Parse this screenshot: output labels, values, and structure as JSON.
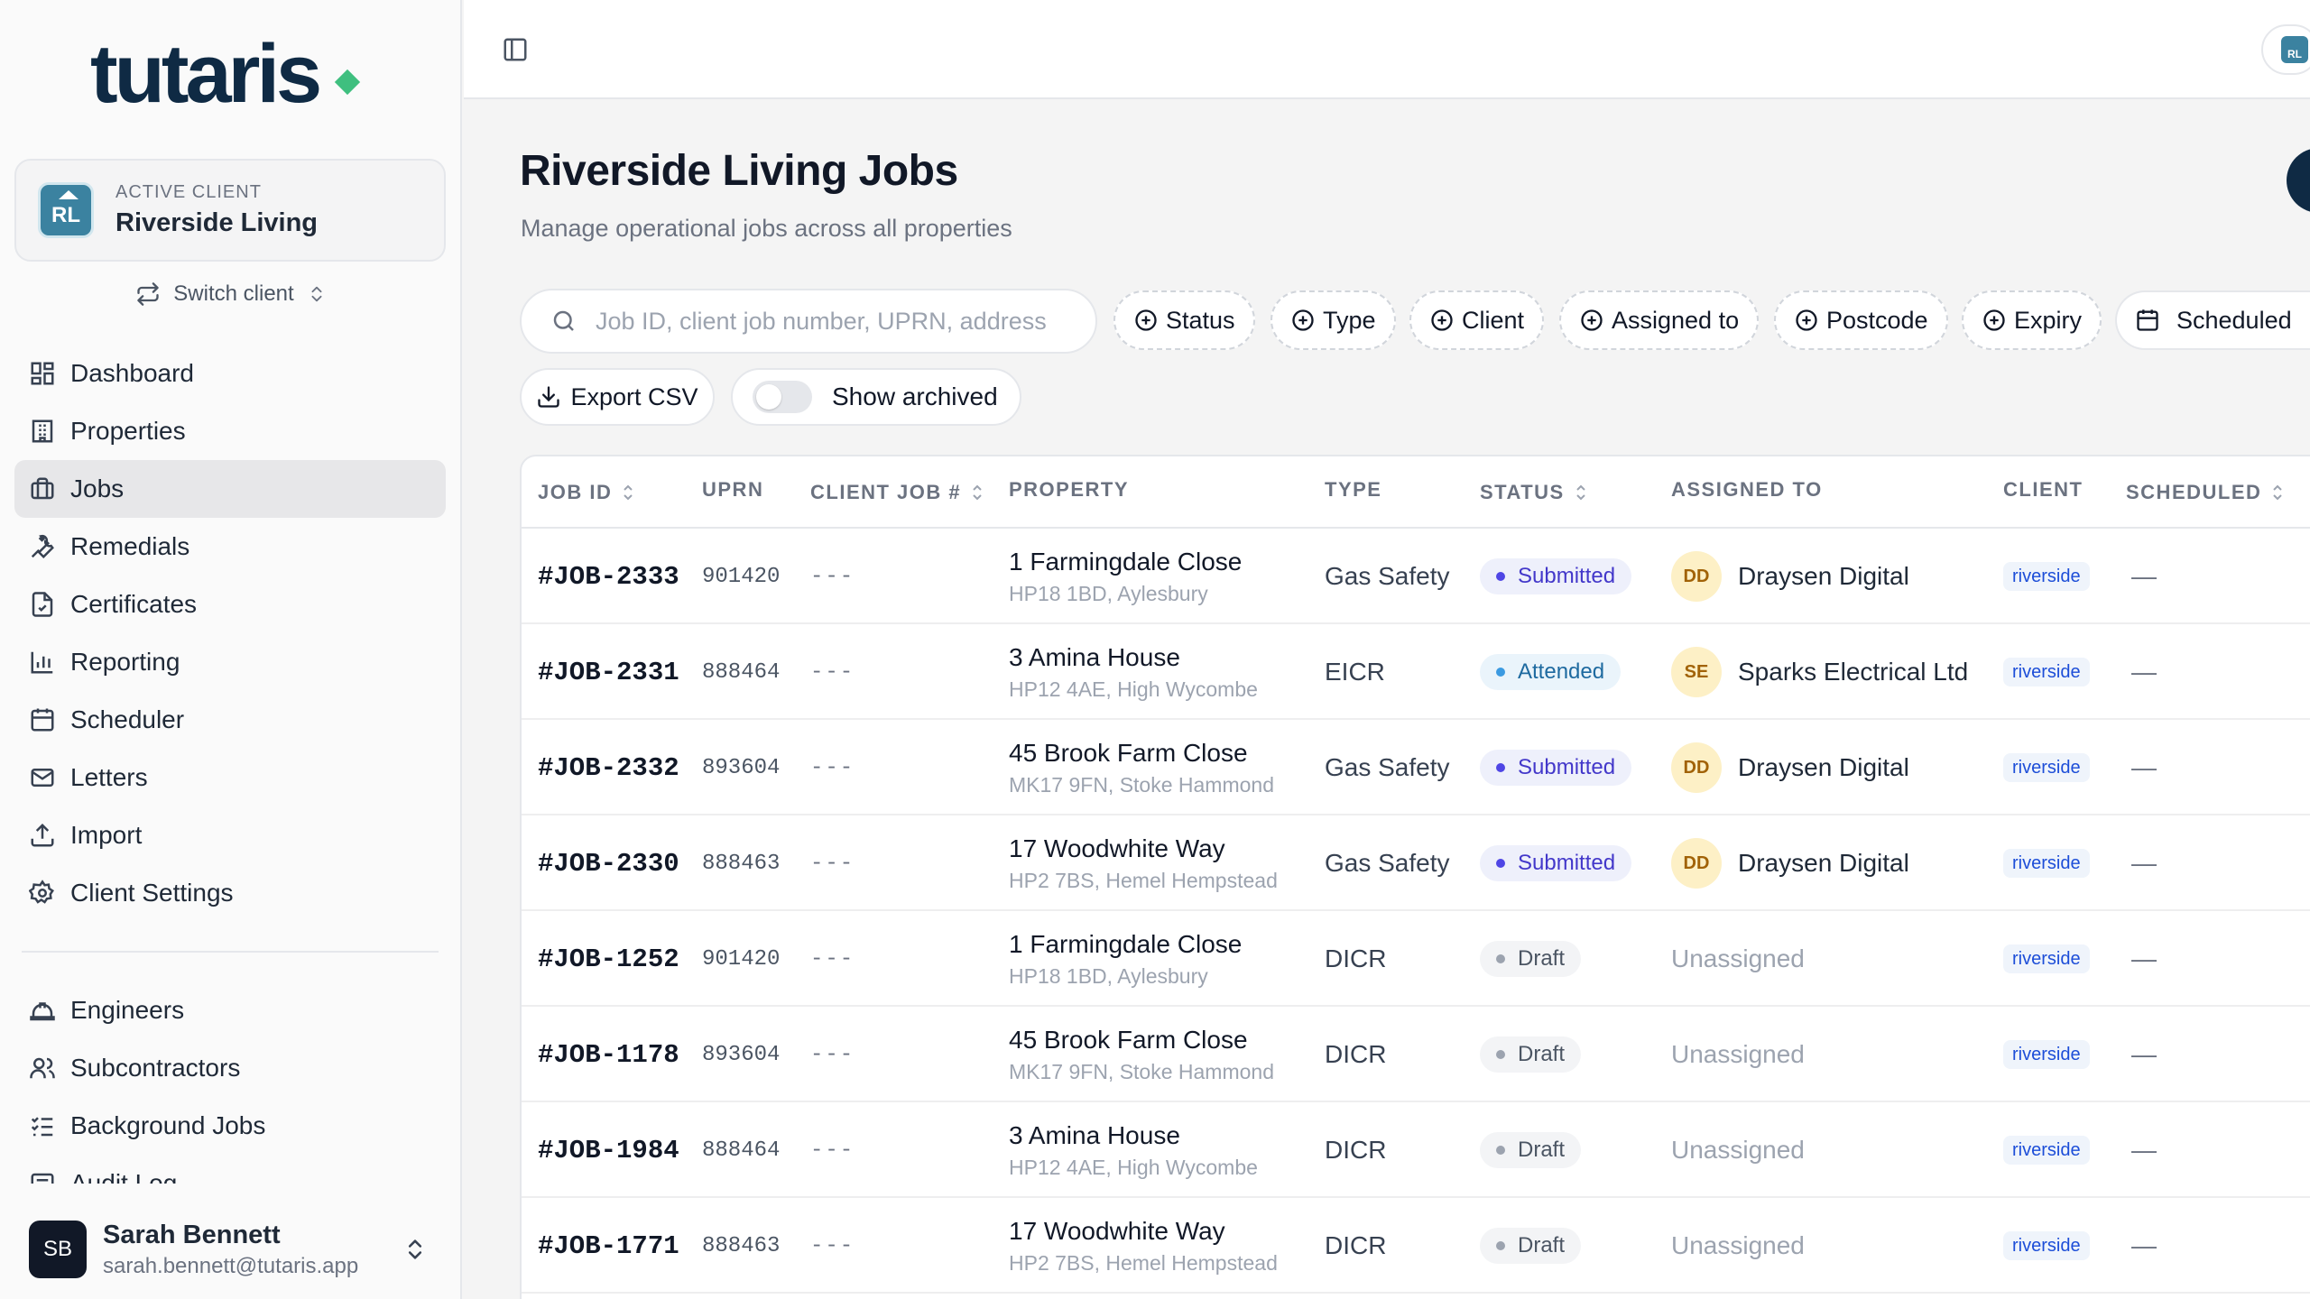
{
  "brand": {
    "logo_text": "tutaris"
  },
  "client_card": {
    "eyebrow": "ACTIVE CLIENT",
    "name": "Riverside Living",
    "initials": "RL"
  },
  "switch_client": {
    "label": "Switch client"
  },
  "nav": {
    "primary": [
      {
        "label": "Dashboard",
        "icon": "dashboard-icon"
      },
      {
        "label": "Properties",
        "icon": "building-icon"
      },
      {
        "label": "Jobs",
        "icon": "briefcase-icon",
        "active": true
      },
      {
        "label": "Remedials",
        "icon": "wrench-icon"
      },
      {
        "label": "Certificates",
        "icon": "file-check-icon"
      },
      {
        "label": "Reporting",
        "icon": "bar-chart-icon"
      },
      {
        "label": "Scheduler",
        "icon": "calendar-icon"
      },
      {
        "label": "Letters",
        "icon": "mail-icon"
      },
      {
        "label": "Import",
        "icon": "upload-icon"
      },
      {
        "label": "Client Settings",
        "icon": "gear-icon"
      }
    ],
    "secondary": [
      {
        "label": "Engineers",
        "icon": "hard-hat-icon"
      },
      {
        "label": "Subcontractors",
        "icon": "users-icon"
      },
      {
        "label": "Background Jobs",
        "icon": "list-checks-icon"
      },
      {
        "label": "Audit Log",
        "icon": "log-icon"
      }
    ]
  },
  "user": {
    "initials": "SB",
    "name": "Sarah Bennett",
    "email": "sarah.bennett@tutaris.app"
  },
  "topbar": {
    "avatar_initials": "RL"
  },
  "page": {
    "title": "Riverside Living Jobs",
    "subtitle": "Manage operational jobs across all properties"
  },
  "filters": {
    "search_placeholder": "Job ID, client job number, UPRN, address",
    "chips": [
      "Status",
      "Type",
      "Client",
      "Assigned to",
      "Postcode",
      "Expiry"
    ],
    "scheduled_label": "Scheduled",
    "export_label": "Export CSV",
    "show_archived_label": "Show archived",
    "show_archived": false
  },
  "table": {
    "columns": [
      "JOB ID",
      "UPRN",
      "CLIENT JOB #",
      "PROPERTY",
      "TYPE",
      "STATUS",
      "ASSIGNED TO",
      "CLIENT",
      "SCHEDULED"
    ],
    "rows": [
      {
        "job_id": "#JOB-2333",
        "uprn": "901420",
        "client_job": "---",
        "address": "1 Farmingdale Close",
        "address_sub": "HP18 1BD, Aylesbury",
        "type": "Gas Safety",
        "status": "Submitted",
        "assignee_initials": "DD",
        "assignee": "Draysen Digital",
        "client": "riverside",
        "scheduled": "—"
      },
      {
        "job_id": "#JOB-2331",
        "uprn": "888464",
        "client_job": "---",
        "address": "3 Amina House",
        "address_sub": "HP12 4AE, High Wycombe",
        "type": "EICR",
        "status": "Attended",
        "assignee_initials": "SE",
        "assignee": "Sparks Electrical Ltd",
        "client": "riverside",
        "scheduled": "—"
      },
      {
        "job_id": "#JOB-2332",
        "uprn": "893604",
        "client_job": "---",
        "address": "45 Brook Farm Close",
        "address_sub": "MK17 9FN, Stoke Hammond",
        "type": "Gas Safety",
        "status": "Submitted",
        "assignee_initials": "DD",
        "assignee": "Draysen Digital",
        "client": "riverside",
        "scheduled": "—"
      },
      {
        "job_id": "#JOB-2330",
        "uprn": "888463",
        "client_job": "---",
        "address": "17 Woodwhite Way",
        "address_sub": "HP2 7BS, Hemel Hempstead",
        "type": "Gas Safety",
        "status": "Submitted",
        "assignee_initials": "DD",
        "assignee": "Draysen Digital",
        "client": "riverside",
        "scheduled": "—"
      },
      {
        "job_id": "#JOB-1252",
        "uprn": "901420",
        "client_job": "---",
        "address": "1 Farmingdale Close",
        "address_sub": "HP18 1BD, Aylesbury",
        "type": "DICR",
        "status": "Draft",
        "assignee_initials": "",
        "assignee": "Unassigned",
        "client": "riverside",
        "scheduled": "—"
      },
      {
        "job_id": "#JOB-1178",
        "uprn": "893604",
        "client_job": "---",
        "address": "45 Brook Farm Close",
        "address_sub": "MK17 9FN, Stoke Hammond",
        "type": "DICR",
        "status": "Draft",
        "assignee_initials": "",
        "assignee": "Unassigned",
        "client": "riverside",
        "scheduled": "—"
      },
      {
        "job_id": "#JOB-1984",
        "uprn": "888464",
        "client_job": "---",
        "address": "3 Amina House",
        "address_sub": "HP12 4AE, High Wycombe",
        "type": "DICR",
        "status": "Draft",
        "assignee_initials": "",
        "assignee": "Unassigned",
        "client": "riverside",
        "scheduled": "—"
      },
      {
        "job_id": "#JOB-1771",
        "uprn": "888463",
        "client_job": "---",
        "address": "17 Woodwhite Way",
        "address_sub": "HP2 7BS, Hemel Hempstead",
        "type": "DICR",
        "status": "Draft",
        "assignee_initials": "",
        "assignee": "Unassigned",
        "client": "riverside",
        "scheduled": "—"
      }
    ]
  },
  "colors": {
    "brand_navy": "#0f2a44",
    "brand_green": "#3fbf7f",
    "client_teal": "#3b82a0"
  }
}
